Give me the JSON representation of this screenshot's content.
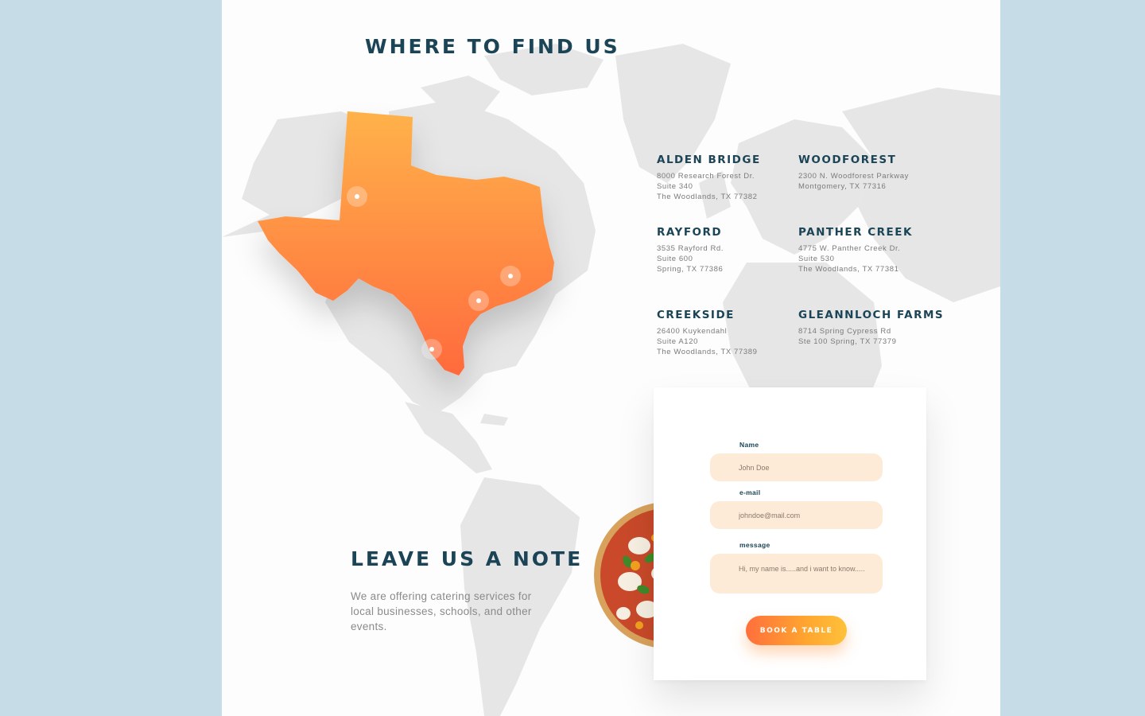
{
  "sections": {
    "find_title": "WHERE TO FIND US",
    "note_title": "LEAVE US A NOTE",
    "note_text": "We are offering catering services for local businesses, schools, and other events."
  },
  "locations": [
    {
      "name": "ALDEN BRIDGE",
      "lines": [
        "8000 Research Forest Dr.",
        "Suite 340",
        "The Woodlands, TX 77382"
      ]
    },
    {
      "name": "WOODFOREST",
      "lines": [
        "2300 N. Woodforest Parkway",
        "Montgomery,  TX  77316"
      ]
    },
    {
      "name": "RAYFORD",
      "lines": [
        "3535 Rayford Rd.",
        "Suite 600",
        "Spring,  TX  77386"
      ]
    },
    {
      "name": "PANTHER CREEK",
      "lines": [
        "4775 W. Panther Creek Dr.",
        "Suite 530",
        "The Woodlands, TX 77381"
      ]
    },
    {
      "name": "CREEKSIDE",
      "lines": [
        "26400 Kuykendahl",
        "Suite A120",
        "The Woodlands, TX 77389"
      ]
    },
    {
      "name": "GLEANNLOCH FARMS",
      "lines": [
        "8714 Spring Cypress Rd",
        "Ste 100 Spring, TX 77379"
      ]
    }
  ],
  "form": {
    "name_label": "Name",
    "name_placeholder": "John Doe",
    "email_label": "e-mail",
    "email_placeholder": "johndoe@mail.com",
    "message_label": "message",
    "message_placeholder": "Hi, my name is.....and i want to know.....",
    "submit_label": "BOOK A TABLE"
  },
  "map": {
    "state": "Texas",
    "pin_count": 4
  },
  "colors": {
    "background": "#c6dde7",
    "heading": "#1b4456",
    "accent_orange": "#ff7a3d",
    "accent_yellow": "#ffb13d",
    "input_bg": "#fdebd8"
  }
}
